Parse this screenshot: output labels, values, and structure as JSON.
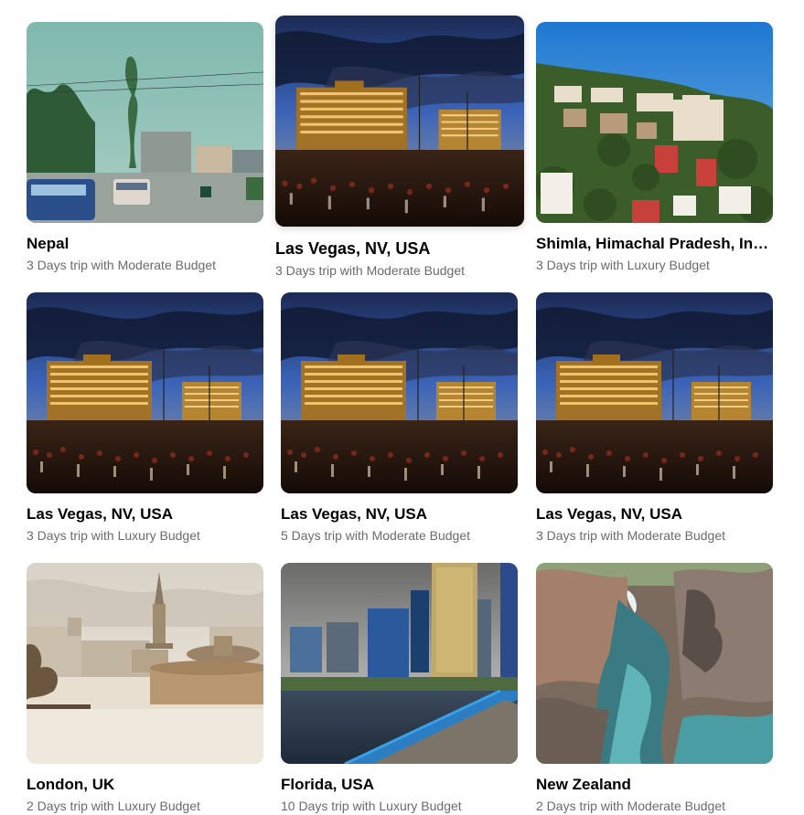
{
  "trips": [
    {
      "title": "Nepal",
      "subtitle": "3 Days trip with Moderate Budget",
      "image": "nepal-street-photo"
    },
    {
      "title": "Las Vegas, NV, USA",
      "subtitle": "3 Days trip with Moderate Budget",
      "image": "las-vegas-bellagio-photo"
    },
    {
      "title": "Shimla, Himachal Pradesh, India",
      "subtitle": "3 Days trip with Luxury Budget",
      "image": "shimla-hillside-photo"
    },
    {
      "title": "Las Vegas, NV, USA",
      "subtitle": "3 Days trip with Luxury Budget",
      "image": "las-vegas-bellagio-photo"
    },
    {
      "title": "Las Vegas, NV, USA",
      "subtitle": "5 Days trip with Moderate Budget",
      "image": "las-vegas-bellagio-photo"
    },
    {
      "title": "Las Vegas, NV, USA",
      "subtitle": "3 Days trip with Moderate Budget",
      "image": "las-vegas-bellagio-photo"
    },
    {
      "title": "London, UK",
      "subtitle": "2 Days trip with Luxury Budget",
      "image": "london-trafalgar-photo"
    },
    {
      "title": "Florida, USA",
      "subtitle": "10 Days trip with Luxury Budget",
      "image": "florida-jacksonville-photo"
    },
    {
      "title": "New Zealand",
      "subtitle": "2 Days trip with Moderate Budget",
      "image": "new-zealand-rock-pool-photo"
    }
  ]
}
